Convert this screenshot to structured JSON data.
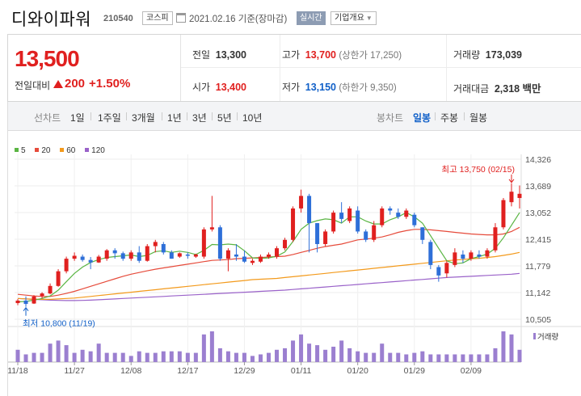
{
  "header": {
    "stock_name": "디와이파워",
    "stock_code": "210540",
    "market": "코스피",
    "date_text": "2021.02.16 기준(장마감)",
    "realtime_label": "실시간",
    "company_label": "기업개요"
  },
  "price": {
    "current": "13,500",
    "prev_label": "전일대비",
    "change_amount": "200",
    "change_rate": "+1.50%",
    "direction": "up"
  },
  "stats": {
    "prev_close_label": "전일",
    "prev_close": "13,300",
    "high_label": "고가",
    "high": "13,700",
    "upper_limit": "(상한가 17,250)",
    "volume_label": "거래량",
    "volume": "173,039",
    "open_label": "시가",
    "open": "13,400",
    "low_label": "저가",
    "low": "13,150",
    "lower_limit": "(하한가 9,350)",
    "amount_label": "거래대금",
    "amount": "2,318",
    "amount_unit": "백만"
  },
  "period_bar": {
    "line_label": "선차트",
    "periods": [
      "1일",
      "1주일",
      "3개월",
      "1년",
      "3년",
      "5년",
      "10년"
    ],
    "candle_label": "봉차트",
    "candles": [
      "일봉",
      "주봉",
      "월봉"
    ],
    "active_candle": "일봉"
  },
  "colors": {
    "up": "#e0201f",
    "down": "#2e6fd8",
    "ma5": "#5ab543",
    "ma20": "#e64b3b",
    "ma60": "#f39a1c",
    "ma120": "#9a62c9",
    "volume": "#9b7fd0"
  },
  "chart_data": {
    "type": "candlestick",
    "legend": [
      "5",
      "20",
      "60",
      "120"
    ],
    "ylim": [
      10505,
      14326
    ],
    "y_ticks": [
      "14,326",
      "13,689",
      "13,052",
      "12,415",
      "11,779",
      "11,142",
      "10,505"
    ],
    "x_ticks": [
      "11/18",
      "11/27",
      "12/08",
      "12/17",
      "12/29",
      "01/11",
      "01/20",
      "01/29",
      "02/09"
    ],
    "x_tick_index": [
      0,
      7,
      14,
      21,
      28,
      35,
      42,
      49,
      56
    ],
    "high_annotation": "최고 13,750 (02/15)",
    "low_annotation": "최저 10,800 (11/19)",
    "volume_label": "거래량",
    "candles": [
      {
        "o": 10890,
        "h": 10990,
        "l": 10840,
        "c": 10950
      },
      {
        "o": 10950,
        "h": 11050,
        "l": 10800,
        "c": 10870
      },
      {
        "o": 10880,
        "h": 11080,
        "l": 10870,
        "c": 11050
      },
      {
        "o": 11060,
        "h": 11150,
        "l": 11000,
        "c": 11120
      },
      {
        "o": 11120,
        "h": 11360,
        "l": 11100,
        "c": 11300
      },
      {
        "o": 11300,
        "h": 11700,
        "l": 11280,
        "c": 11650
      },
      {
        "o": 11650,
        "h": 12000,
        "l": 11600,
        "c": 11950
      },
      {
        "o": 11950,
        "h": 12100,
        "l": 11900,
        "c": 12020
      },
      {
        "o": 12000,
        "h": 12050,
        "l": 11880,
        "c": 11920
      },
      {
        "o": 11920,
        "h": 11990,
        "l": 11700,
        "c": 11860
      },
      {
        "o": 11860,
        "h": 12040,
        "l": 11850,
        "c": 12000
      },
      {
        "o": 11950,
        "h": 12180,
        "l": 11900,
        "c": 12150
      },
      {
        "o": 12150,
        "h": 12200,
        "l": 11950,
        "c": 12080
      },
      {
        "o": 12080,
        "h": 12120,
        "l": 11900,
        "c": 11950
      },
      {
        "o": 11950,
        "h": 12150,
        "l": 11900,
        "c": 12100
      },
      {
        "o": 12100,
        "h": 12250,
        "l": 11850,
        "c": 11900
      },
      {
        "o": 11900,
        "h": 12300,
        "l": 11880,
        "c": 12250
      },
      {
        "o": 12250,
        "h": 12400,
        "l": 12100,
        "c": 12350
      },
      {
        "o": 12300,
        "h": 12350,
        "l": 12050,
        "c": 12100
      },
      {
        "o": 12100,
        "h": 12150,
        "l": 11950,
        "c": 11950
      },
      {
        "o": 12000,
        "h": 12100,
        "l": 11970,
        "c": 12080
      },
      {
        "o": 12050,
        "h": 12100,
        "l": 11950,
        "c": 12020
      },
      {
        "o": 12000,
        "h": 12070,
        "l": 11970,
        "c": 12050
      },
      {
        "o": 12000,
        "h": 12700,
        "l": 11950,
        "c": 12650
      },
      {
        "o": 12650,
        "h": 13450,
        "l": 12600,
        "c": 12700
      },
      {
        "o": 12700,
        "h": 12750,
        "l": 11900,
        "c": 11950
      },
      {
        "o": 11950,
        "h": 12200,
        "l": 11650,
        "c": 12150
      },
      {
        "o": 12050,
        "h": 12300,
        "l": 11900,
        "c": 12000
      },
      {
        "o": 12000,
        "h": 12150,
        "l": 11850,
        "c": 11880
      },
      {
        "o": 11850,
        "h": 11950,
        "l": 11800,
        "c": 11900
      },
      {
        "o": 11880,
        "h": 12050,
        "l": 11850,
        "c": 12000
      },
      {
        "o": 12000,
        "h": 12100,
        "l": 11950,
        "c": 12050
      },
      {
        "o": 12000,
        "h": 12250,
        "l": 11950,
        "c": 12200
      },
      {
        "o": 12200,
        "h": 12450,
        "l": 12150,
        "c": 12400
      },
      {
        "o": 12400,
        "h": 13200,
        "l": 12350,
        "c": 13150
      },
      {
        "o": 13150,
        "h": 13600,
        "l": 13050,
        "c": 13450
      },
      {
        "o": 13450,
        "h": 13500,
        "l": 12100,
        "c": 12800
      },
      {
        "o": 12800,
        "h": 12800,
        "l": 12100,
        "c": 12300
      },
      {
        "o": 12300,
        "h": 12650,
        "l": 12250,
        "c": 12600
      },
      {
        "o": 12600,
        "h": 13100,
        "l": 12550,
        "c": 13050
      },
      {
        "o": 13050,
        "h": 13300,
        "l": 12800,
        "c": 12900
      },
      {
        "o": 12850,
        "h": 13200,
        "l": 12800,
        "c": 13150
      },
      {
        "o": 13100,
        "h": 13200,
        "l": 12550,
        "c": 12600
      },
      {
        "o": 12600,
        "h": 12650,
        "l": 12350,
        "c": 12400
      },
      {
        "o": 12400,
        "h": 12850,
        "l": 12350,
        "c": 12750
      },
      {
        "o": 12750,
        "h": 13200,
        "l": 12700,
        "c": 13150
      },
      {
        "o": 13150,
        "h": 13200,
        "l": 13000,
        "c": 13100
      },
      {
        "o": 13050,
        "h": 13150,
        "l": 12900,
        "c": 12950
      },
      {
        "o": 12950,
        "h": 13150,
        "l": 12900,
        "c": 13100
      },
      {
        "o": 13000,
        "h": 13050,
        "l": 12700,
        "c": 12750
      },
      {
        "o": 12700,
        "h": 12700,
        "l": 12300,
        "c": 12400
      },
      {
        "o": 12350,
        "h": 12400,
        "l": 11700,
        "c": 11800
      },
      {
        "o": 11750,
        "h": 11800,
        "l": 11400,
        "c": 11550
      },
      {
        "o": 11600,
        "h": 11900,
        "l": 11500,
        "c": 11850
      },
      {
        "o": 11800,
        "h": 12200,
        "l": 11750,
        "c": 12100
      },
      {
        "o": 12050,
        "h": 12150,
        "l": 11850,
        "c": 11950
      },
      {
        "o": 11950,
        "h": 12150,
        "l": 11900,
        "c": 12100
      },
      {
        "o": 12050,
        "h": 12150,
        "l": 11950,
        "c": 12000
      },
      {
        "o": 12000,
        "h": 12200,
        "l": 11950,
        "c": 12150
      },
      {
        "o": 12150,
        "h": 12800,
        "l": 12100,
        "c": 12700
      },
      {
        "o": 12700,
        "h": 13400,
        "l": 12650,
        "c": 13350
      },
      {
        "o": 13300,
        "h": 13750,
        "l": 13200,
        "c": 13550
      },
      {
        "o": 13400,
        "h": 13700,
        "l": 13150,
        "c": 13500
      }
    ],
    "ma5": [
      10920,
      10930,
      10960,
      11000,
      11060,
      11200,
      11400,
      11600,
      11750,
      11860,
      11930,
      11980,
      12000,
      12020,
      12040,
      12000,
      12030,
      12120,
      12140,
      12100,
      12130,
      12100,
      12050,
      12150,
      12290,
      12280,
      12300,
      12280,
      12140,
      11970,
      11960,
      11970,
      12010,
      12110,
      12360,
      12650,
      12800,
      12860,
      12900,
      12880,
      12800,
      12950,
      12950,
      12850,
      12780,
      12780,
      12880,
      12950,
      13050,
      12950,
      12800,
      12500,
      12200,
      11900,
      11830,
      11850,
      11950,
      12000,
      12060,
      12200,
      12450,
      12750,
      13050
    ],
    "ma20": [
      11100,
      11080,
      11060,
      11050,
      11050,
      11080,
      11120,
      11170,
      11230,
      11290,
      11350,
      11410,
      11470,
      11530,
      11580,
      11620,
      11660,
      11700,
      11730,
      11760,
      11790,
      11820,
      11850,
      11880,
      11910,
      11920,
      11930,
      11950,
      11960,
      11970,
      11980,
      11990,
      12000,
      12010,
      12050,
      12100,
      12150,
      12200,
      12240,
      12270,
      12300,
      12350,
      12400,
      12420,
      12440,
      12470,
      12520,
      12580,
      12620,
      12650,
      12650,
      12640,
      12620,
      12600,
      12580,
      12560,
      12540,
      12530,
      12520,
      12520,
      12540,
      12600,
      12700
    ],
    "ma60": [
      11000,
      10990,
      10985,
      10980,
      10980,
      10990,
      11000,
      11010,
      11030,
      11050,
      11070,
      11090,
      11110,
      11130,
      11150,
      11170,
      11190,
      11210,
      11230,
      11250,
      11270,
      11290,
      11310,
      11330,
      11350,
      11370,
      11390,
      11410,
      11430,
      11450,
      11460,
      11470,
      11480,
      11500,
      11520,
      11540,
      11560,
      11580,
      11600,
      11620,
      11640,
      11660,
      11680,
      11700,
      11720,
      11740,
      11760,
      11780,
      11800,
      11820,
      11840,
      11860,
      11880,
      11900,
      11920,
      11930,
      11950,
      11960,
      11980,
      12000,
      12030,
      12060,
      12100
    ],
    "ma120": [
      11000,
      10990,
      10980,
      10970,
      10960,
      10955,
      10950,
      10950,
      10955,
      10960,
      10970,
      10980,
      10990,
      11000,
      11010,
      11020,
      11030,
      11040,
      11050,
      11060,
      11070,
      11080,
      11090,
      11100,
      11110,
      11120,
      11130,
      11140,
      11150,
      11160,
      11170,
      11180,
      11190,
      11200,
      11215,
      11230,
      11245,
      11260,
      11275,
      11290,
      11305,
      11320,
      11335,
      11350,
      11365,
      11380,
      11395,
      11410,
      11425,
      11440,
      11455,
      11470,
      11485,
      11500,
      11510,
      11520,
      11530,
      11540,
      11550,
      11560,
      11570,
      11580,
      11600
    ],
    "volume": [
      40,
      25,
      30,
      30,
      60,
      70,
      55,
      30,
      40,
      35,
      60,
      30,
      30,
      30,
      20,
      35,
      30,
      30,
      35,
      35,
      35,
      30,
      30,
      90,
      100,
      45,
      35,
      30,
      30,
      20,
      25,
      30,
      40,
      45,
      70,
      90,
      60,
      55,
      40,
      50,
      70,
      45,
      35,
      30,
      30,
      60,
      30,
      30,
      25,
      30,
      35,
      25,
      25,
      25,
      25,
      25,
      25,
      25,
      25,
      45,
      100,
      90,
      40
    ]
  }
}
